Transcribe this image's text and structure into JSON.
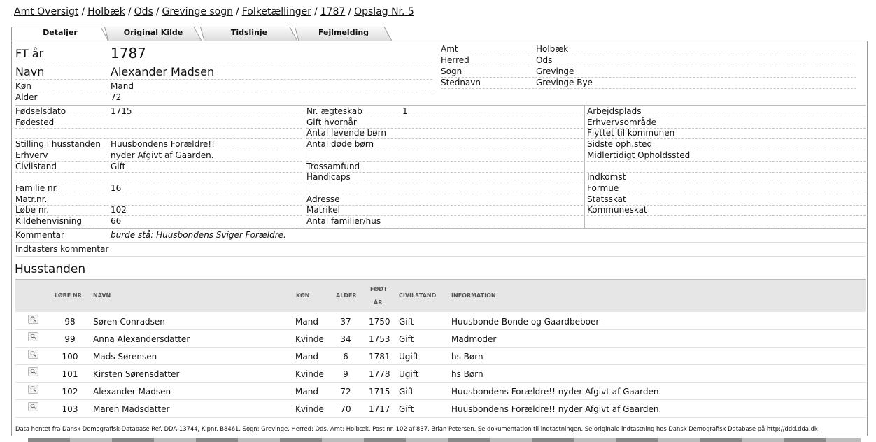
{
  "breadcrumb": [
    {
      "label": "Amt Oversigt"
    },
    {
      "label": "Holbæk"
    },
    {
      "label": "Ods"
    },
    {
      "label": "Grevinge sogn"
    },
    {
      "label": "Folketællinger"
    },
    {
      "label": "1787"
    },
    {
      "label": "Opslag Nr. 5"
    }
  ],
  "breadcrumb_sep": "/",
  "tabs": [
    {
      "label": "Detaljer",
      "active": true
    },
    {
      "label": "Original Kilde"
    },
    {
      "label": "Tidslinje"
    },
    {
      "label": "Fejlmelding"
    }
  ],
  "top": {
    "ft_label": "FT år",
    "ft_value": "1787",
    "navn_label": "Navn",
    "navn_value": "Alexander Madsen",
    "kon_label": "Køn",
    "kon_value": "Mand",
    "alder_label": "Alder",
    "alder_value": "72"
  },
  "place": [
    {
      "k": "Amt",
      "v": "Holbæk"
    },
    {
      "k": "Herred",
      "v": "Ods"
    },
    {
      "k": "Sogn",
      "v": "Grevinge"
    },
    {
      "k": "Stednavn",
      "v": "Grevinge Bye"
    }
  ],
  "col1": [
    {
      "k": "Fødselsdato",
      "v": "1715"
    },
    {
      "k": "Fødested",
      "v": ""
    },
    {
      "k": "",
      "v": ""
    },
    {
      "k": "Stilling i husstanden",
      "v": "Huusbondens Forældre!!"
    },
    {
      "k": "Erhverv",
      "v": "nyder Afgivt af Gaarden."
    },
    {
      "k": "Civilstand",
      "v": "Gift"
    },
    {
      "k": "",
      "v": ""
    },
    {
      "k": "Familie nr.",
      "v": "16"
    },
    {
      "k": "Matr.nr.",
      "v": ""
    },
    {
      "k": "Løbe nr.",
      "v": "102"
    },
    {
      "k": "Kildehenvisning",
      "v": "66"
    }
  ],
  "col2": [
    {
      "k": "Nr. ægteskab",
      "v": "1"
    },
    {
      "k": "Gift hvornår",
      "v": ""
    },
    {
      "k": "Antal levende børn",
      "v": ""
    },
    {
      "k": "Antal døde børn",
      "v": ""
    },
    {
      "k": "",
      "v": ""
    },
    {
      "k": "Trossamfund",
      "v": ""
    },
    {
      "k": "Handicaps",
      "v": ""
    },
    {
      "k": "",
      "v": ""
    },
    {
      "k": "Adresse",
      "v": ""
    },
    {
      "k": "Matrikel",
      "v": ""
    },
    {
      "k": "Antal familier/hus",
      "v": ""
    }
  ],
  "col3": [
    {
      "k": "Arbejdsplads"
    },
    {
      "k": "Erhvervsområde"
    },
    {
      "k": "Flyttet til kommunen"
    },
    {
      "k": "Sidste oph.sted"
    },
    {
      "k": "Midlertidigt Opholdssted"
    },
    {
      "k": ""
    },
    {
      "k": "Indkomst"
    },
    {
      "k": "Formue"
    },
    {
      "k": "Statsskat"
    },
    {
      "k": "Kommuneskat"
    },
    {
      "k": ""
    }
  ],
  "kommentar_label": "Kommentar",
  "kommentar_value": "burde stå: Huusbondens Sviger Forældre.",
  "indtaster_label": "Indtasters kommentar",
  "husstanden_title": "Husstanden",
  "table": {
    "headers": {
      "lobe": "LØBE NR.",
      "navn": "NAVN",
      "kon": "KØN",
      "alder": "ALDER",
      "fodt1": "FØDT",
      "fodt2": "ÅR",
      "civil": "CIVILSTAND",
      "info": "INFORMATION"
    },
    "rows": [
      {
        "lobe": "98",
        "navn": "Søren Conradsen",
        "kon": "Mand",
        "alder": "37",
        "fodt": "1750",
        "civil": "Gift",
        "info": "Huusbonde Bonde og Gaardbeboer"
      },
      {
        "lobe": "99",
        "navn": "Anna Alexandersdatter",
        "kon": "Kvinde",
        "alder": "34",
        "fodt": "1753",
        "civil": "Gift",
        "info": "Madmoder"
      },
      {
        "lobe": "100",
        "navn": "Mads Sørensen",
        "kon": "Mand",
        "alder": "6",
        "fodt": "1781",
        "civil": "Ugift",
        "info": "hs Børn"
      },
      {
        "lobe": "101",
        "navn": "Kirsten Sørensdatter",
        "kon": "Kvinde",
        "alder": "9",
        "fodt": "1778",
        "civil": "Ugift",
        "info": "hs Børn"
      },
      {
        "lobe": "102",
        "navn": "Alexander Madsen",
        "kon": "Mand",
        "alder": "72",
        "fodt": "1715",
        "civil": "Gift",
        "info": "Huusbondens Forældre!! nyder Afgivt af Gaarden."
      },
      {
        "lobe": "103",
        "navn": "Maren Madsdatter",
        "kon": "Kvinde",
        "alder": "70",
        "fodt": "1717",
        "civil": "Gift",
        "info": "Huusbondens Forældre!! nyder Afgivt af Gaarden."
      }
    ]
  },
  "footer": {
    "text1": "Data hentet fra Dansk Demografisk Database Ref. DDA-13744, Kipnr. B8461. Sogn: Grevinge. Herred: Ods. Amt: Holbæk. Post nr. 102 af 837. Brian Petersen. ",
    "link1": "Se dokumentation til indtastningen",
    "text2": ". Se originale indtastning hos Dansk Demografisk Database på ",
    "link2": "http://ddd.dda.dk"
  }
}
